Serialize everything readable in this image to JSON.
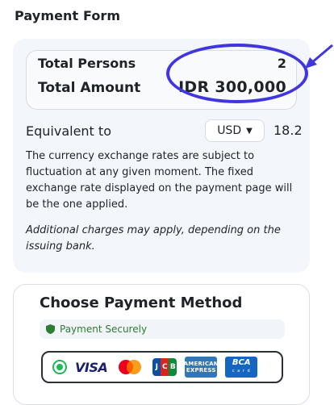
{
  "form": {
    "title": "Payment Form"
  },
  "summary": {
    "total_persons_label": "Total Persons",
    "total_persons_value": "2",
    "total_amount_label": "Total Amount",
    "total_amount_value": "IDR 300,000"
  },
  "equivalent": {
    "label": "Equivalent to",
    "currency": "USD",
    "value": "18.2"
  },
  "notes": {
    "rates": "The currency exchange rates are subject to fluctuation at any given moment. The fixed exchange rate displayed on the payment page will be the one applied.",
    "charges": "Additional charges may apply, depending on the issuing bank."
  },
  "payment": {
    "title": "Choose Payment Method",
    "secure_label": "Payment Securely",
    "method_selected": true,
    "logos": {
      "visa": "VISA",
      "jcb": [
        "J",
        "C",
        "B"
      ],
      "amex_line1": "AMERICAN",
      "amex_line2": "EXPRESS",
      "bca_main": "BCA",
      "bca_sub": "c a r d"
    }
  },
  "colors": {
    "annotation": "#3f36e0",
    "radio_selected": "#1db954",
    "secure_text": "#2e7d32",
    "card_background": "#f3f6fb"
  },
  "icons": {
    "secure": "shield-icon",
    "dropdown": "chevron-down-icon",
    "annotation": "arrow-icon"
  }
}
